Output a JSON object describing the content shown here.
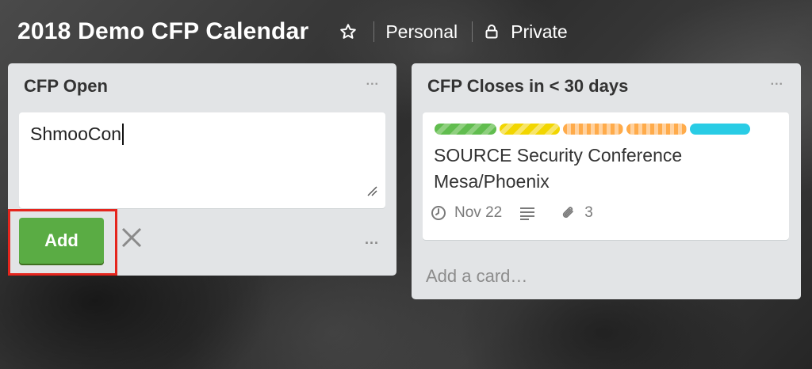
{
  "board": {
    "title": "2018 Demo CFP Calendar",
    "visibility_team": "Personal",
    "visibility_privacy": "Private"
  },
  "lists": [
    {
      "title": "CFP Open",
      "menu": "...",
      "composer": {
        "value": "ShmooCon",
        "add_label": "Add",
        "more": "..."
      }
    },
    {
      "title": "CFP Closes in < 30 days",
      "menu": "...",
      "cards": [
        {
          "title": "SOURCE Security Conference Mesa/Phoenix",
          "labels": [
            "green-striped",
            "yellow-striped",
            "orange-striped",
            "orange-striped",
            "blue"
          ],
          "due": "Nov 22",
          "attachments": "3"
        }
      ],
      "add_card": "Add a card…"
    }
  ],
  "colors": {
    "add_button": "#5aac44",
    "highlight": "#e5251d",
    "list_bg": "#e2e4e6"
  }
}
